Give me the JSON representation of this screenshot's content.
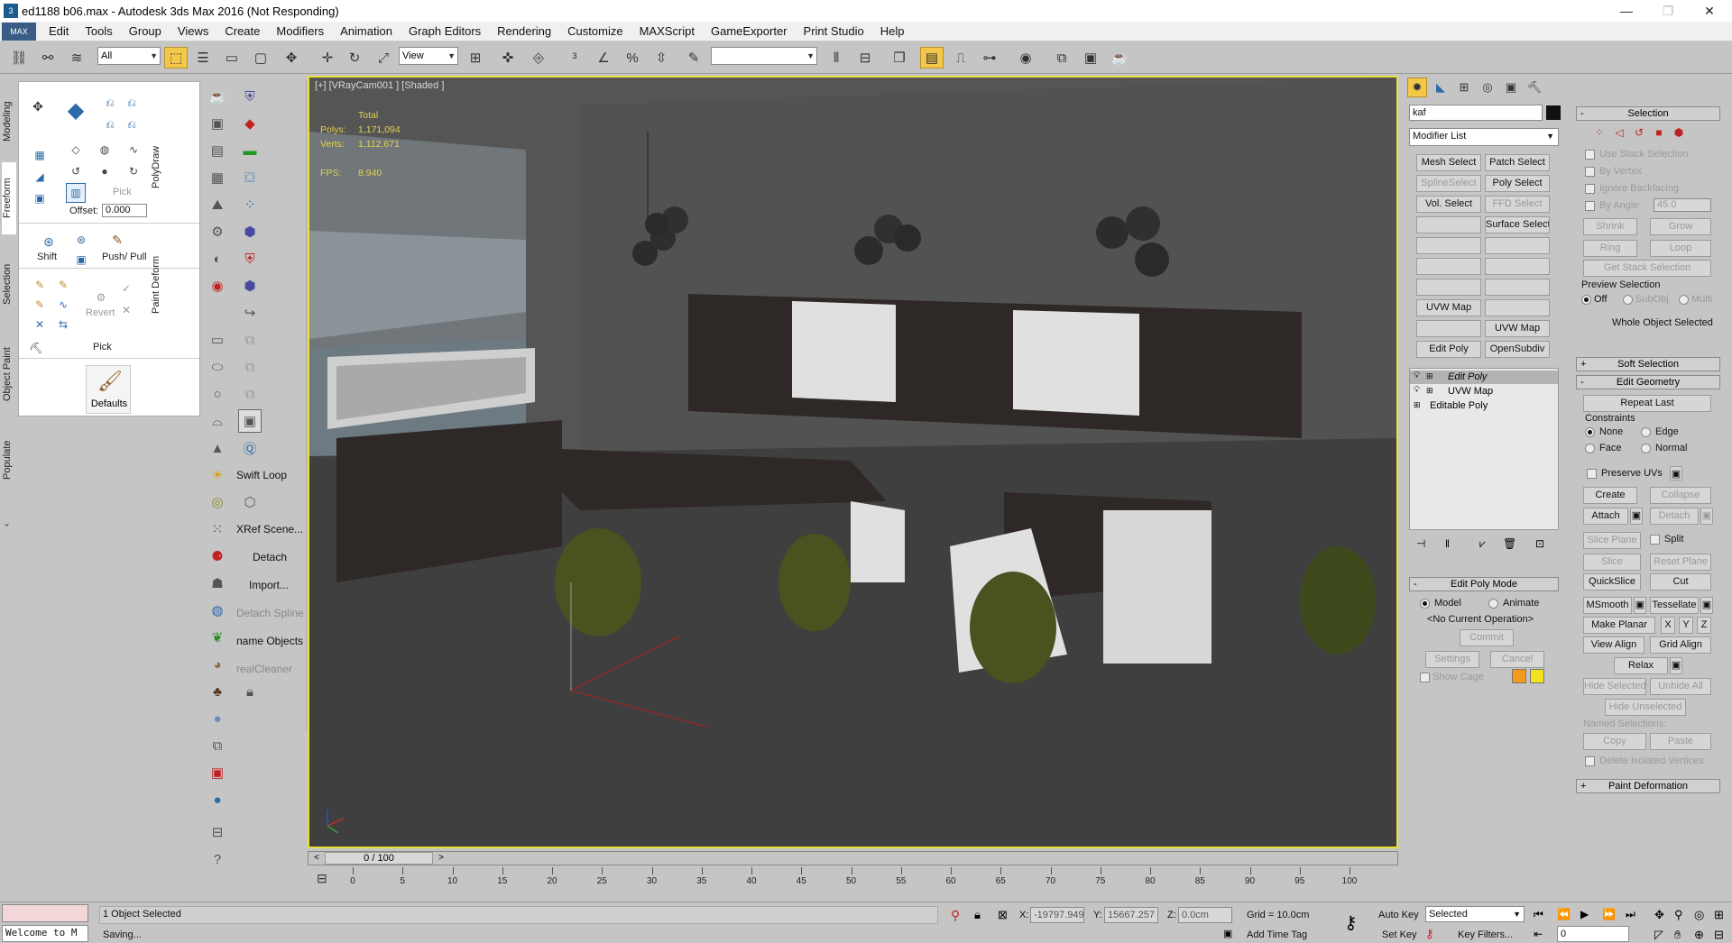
{
  "window": {
    "title": "ed1188 b06.max - Autodesk 3ds Max 2016  (Not Responding)",
    "app_icon": "3ds-max-logo-icon",
    "minimize": "—",
    "restore": "❐",
    "close": "✕"
  },
  "menu": {
    "max_button": "MAX",
    "items": [
      "Edit",
      "Tools",
      "Group",
      "Views",
      "Create",
      "Modifiers",
      "Animation",
      "Graph Editors",
      "Rendering",
      "Customize",
      "MAXScript",
      "GameExporter",
      "Print Studio",
      "Help"
    ]
  },
  "toolbar": {
    "selection_filter": "All",
    "ref_coord": "View",
    "named_selection": ""
  },
  "left_tabs": [
    "Modeling",
    "Freeform",
    "Selection",
    "Object Paint",
    "Populate"
  ],
  "ribbon": {
    "pick_label": "Pick",
    "offset_label": "Offset:",
    "offset_value": "0.000",
    "shift_label": "Shift",
    "push_pull_label": "Push/ Pull",
    "revert_label": "Revert",
    "pick2_label": "Pick",
    "defaults_label": "Defaults",
    "polydraw_label": "PolyDraw",
    "paint_deform_label": "Paint Deform"
  },
  "command_strip": {
    "labels": [
      "Swift Loop",
      "XRef Scene...",
      "Detach",
      "Import...",
      "Detach Spline",
      "name Objects",
      "realCleaner"
    ]
  },
  "viewport": {
    "label": "[+] [VRayCam001 ] [Shaded ]",
    "stats_header": "Total",
    "polys_label": "Polys:",
    "polys_value": "1,171,094",
    "verts_label": "Verts:",
    "verts_value": "1,112,671",
    "fps_label": "FPS:",
    "fps_value": "8.940",
    "border_color": "#e8df3a"
  },
  "time_slider": {
    "value": "0 / 100",
    "ticks": [
      "0",
      "5",
      "10",
      "15",
      "20",
      "25",
      "30",
      "35",
      "40",
      "45",
      "50",
      "55",
      "60",
      "65",
      "70",
      "75",
      "80",
      "85",
      "90",
      "95",
      "100"
    ]
  },
  "modify_panel": {
    "object_name": "kaf",
    "modifier_list": "Modifier List",
    "buttons": [
      [
        "Mesh Select",
        "Patch Select"
      ],
      [
        "SplineSelect",
        "Poly Select"
      ],
      [
        "Vol. Select",
        "FFD Select"
      ],
      [
        "",
        "Surface Select"
      ],
      [
        "",
        ""
      ],
      [
        "",
        ""
      ],
      [
        "",
        ""
      ],
      [
        "UVW Map",
        ""
      ],
      [
        "",
        "UVW Map"
      ],
      [
        "Edit Poly",
        "OpenSubdiv"
      ]
    ],
    "stack": [
      "Edit Poly",
      "UVW Map",
      "Editable Poly"
    ],
    "edit_poly_mode": "Edit Poly Mode",
    "model_label": "Model",
    "animate_label": "Animate",
    "no_op": "<No Current Operation>",
    "commit": "Commit",
    "settings": "Settings",
    "cancel": "Cancel",
    "show_cage": "Show Cage",
    "cage_color_1": "#f39a1e",
    "cage_color_2": "#f3e21e"
  },
  "selection_panel": {
    "selection_hdr": "Selection",
    "use_stack_selection": "Use Stack Selection",
    "by_vertex": "By Vertex",
    "ignore_backfacing": "Ignore Backfacing",
    "by_angle": "By Angle:",
    "by_angle_value": "45.0",
    "shrink": "Shrink",
    "grow": "Grow",
    "ring": "Ring",
    "loop": "Loop",
    "get_stack_selection": "Get Stack Selection",
    "preview_selection": "Preview Selection",
    "off": "Off",
    "subobj": "SubObj",
    "multi": "Multi",
    "whole_object_selected": "Whole Object Selected",
    "soft_selection_hdr": "Soft Selection",
    "edit_geometry_hdr": "Edit Geometry",
    "repeat_last": "Repeat Last",
    "constraints": "Constraints",
    "none": "None",
    "edge": "Edge",
    "face": "Face",
    "normal": "Normal",
    "preserve_uvs": "Preserve UVs",
    "create": "Create",
    "collapse": "Collapse",
    "attach": "Attach",
    "detach": "Detach",
    "slice_plane": "Slice Plane",
    "split": "Split",
    "slice": "Slice",
    "reset_plane": "Reset Plane",
    "quickslice": "QuickSlice",
    "cut": "Cut",
    "msmooth": "MSmooth",
    "tessellate": "Tessellate",
    "make_planar": "Make Planar",
    "x": "X",
    "y": "Y",
    "z": "Z",
    "view_align": "View Align",
    "grid_align": "Grid Align",
    "relax": "Relax",
    "hide_selected": "Hide Selected",
    "unhide_all": "Unhide All",
    "hide_unselected": "Hide Unselected",
    "named_selections": "Named Selections:",
    "copy": "Copy",
    "paste": "Paste",
    "delete_isolated_vertices": "Delete Isolated Vertices",
    "paint_deformation_hdr": "Paint Deformation"
  },
  "status": {
    "maxscript_listener": "",
    "welcome": "Welcome to M",
    "objects_selected": "1 Object Selected",
    "prompt": "Saving...",
    "x_label": "X:",
    "x_value": "-19797.949",
    "y_label": "Y:",
    "y_value": "15667.257",
    "z_label": "Z:",
    "z_value": "0.0cm",
    "grid": "Grid = 10.0cm",
    "add_time_tag": "Add Time Tag",
    "auto_key": "Auto Key",
    "set_key": "Set Key",
    "selected": "Selected",
    "key_filters": "Key Filters...",
    "frame": "0"
  }
}
